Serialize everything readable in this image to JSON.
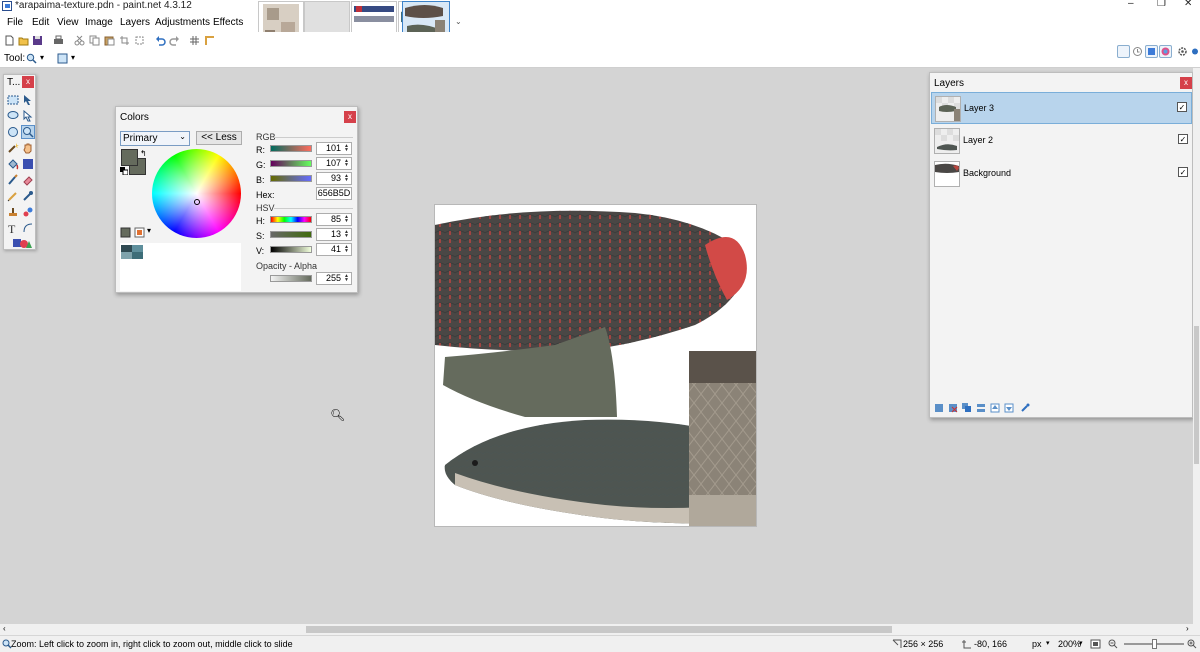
{
  "window": {
    "title": "*arapaima-texture.pdn - paint.net 4.3.12",
    "minimize": "–",
    "restore": "❐",
    "close": "✕"
  },
  "menu": [
    "File",
    "Edit",
    "View",
    "Image",
    "Layers",
    "Adjustments",
    "Effects"
  ],
  "toolbar": {
    "tool_label": "Tool:"
  },
  "tools_window": {
    "title": "T...",
    "close": "x"
  },
  "colors_window": {
    "title": "Colors",
    "close": "x",
    "selector": "Primary",
    "less_button": "<< Less",
    "rgb_label": "RGB",
    "hsv_label": "HSV",
    "hex_label": "Hex:",
    "hex_value": "656B5D",
    "channels": {
      "r": {
        "label": "R:",
        "value": "101"
      },
      "g": {
        "label": "G:",
        "value": "107"
      },
      "b": {
        "label": "B:",
        "value": "93"
      },
      "h": {
        "label": "H:",
        "value": "85"
      },
      "s": {
        "label": "S:",
        "value": "13"
      },
      "v": {
        "label": "V:",
        "value": "41"
      }
    },
    "opacity_label": "Opacity - Alpha",
    "alpha_value": "255",
    "primary_color": "#656B5D"
  },
  "layers_window": {
    "title": "Layers",
    "close": "x",
    "layers": [
      {
        "name": "Layer 3",
        "visible": true,
        "selected": true
      },
      {
        "name": "Layer 2",
        "visible": true,
        "selected": false
      },
      {
        "name": "Background",
        "visible": true,
        "selected": false
      }
    ]
  },
  "status": {
    "hint": "Zoom: Left click to zoom in, right click to zoom out, middle click to slide",
    "image_size": "256 × 256",
    "cursor_pos": "-80, 166",
    "units": "px",
    "zoom": "200%"
  }
}
